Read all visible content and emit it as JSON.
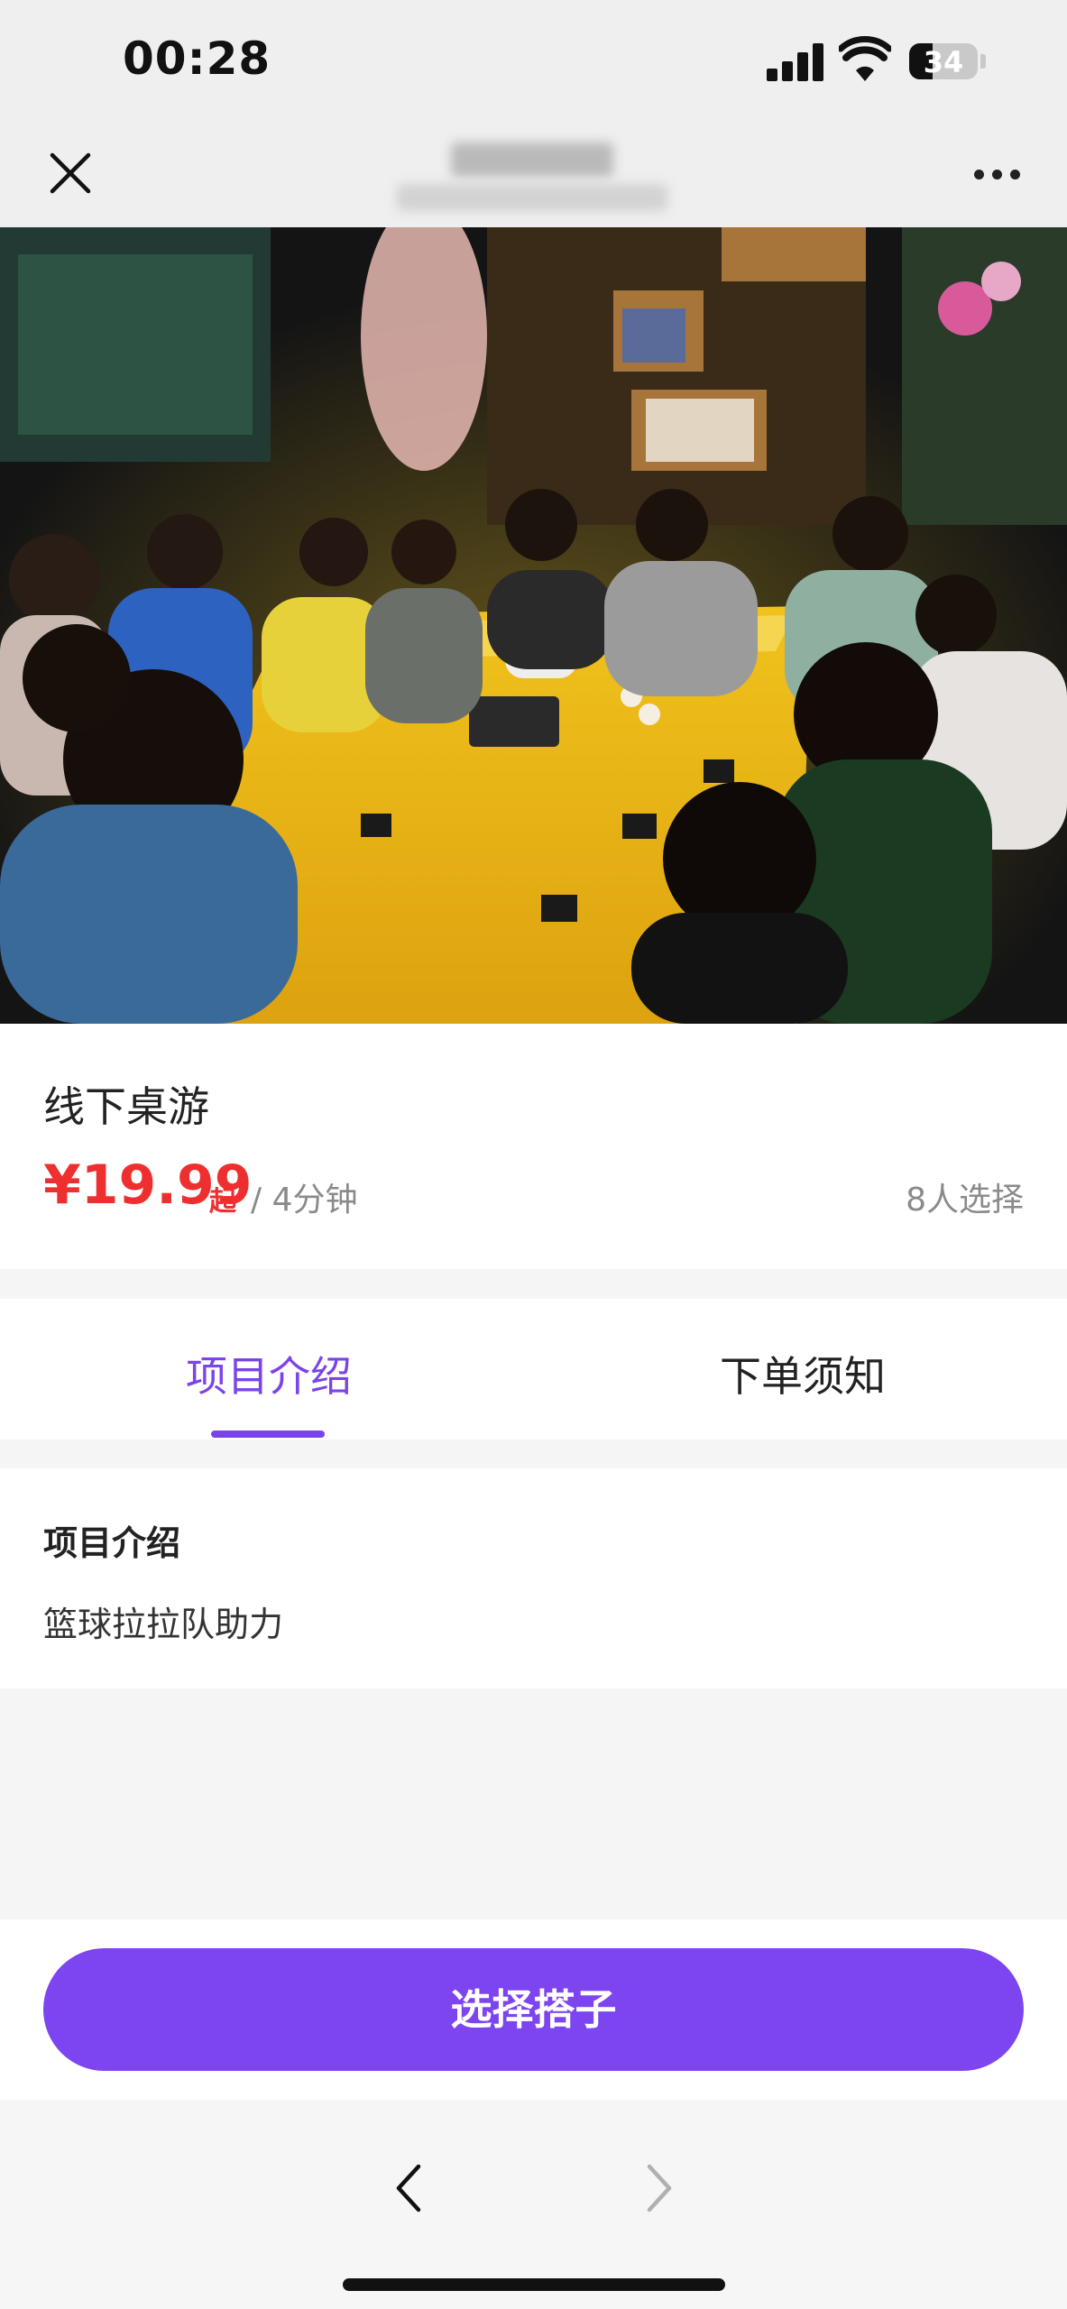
{
  "status_bar": {
    "time": "00:28",
    "battery": "34"
  },
  "nav": {
    "close_icon": "close-icon",
    "more_icon": "more-icon"
  },
  "product": {
    "title": "线下桌游",
    "price": "¥19.99",
    "price_suffix": "起",
    "duration": "/ 4分钟",
    "selected_count": "8人选择"
  },
  "tabs": [
    {
      "label": "项目介绍",
      "active": true
    },
    {
      "label": "下单须知",
      "active": false
    }
  ],
  "intro": {
    "heading": "项目介绍",
    "body": "篮球拉拉队助力"
  },
  "action": {
    "primary_label": "选择搭子"
  },
  "colors": {
    "accent": "#7c45f0",
    "price": "#ee2f2f"
  }
}
